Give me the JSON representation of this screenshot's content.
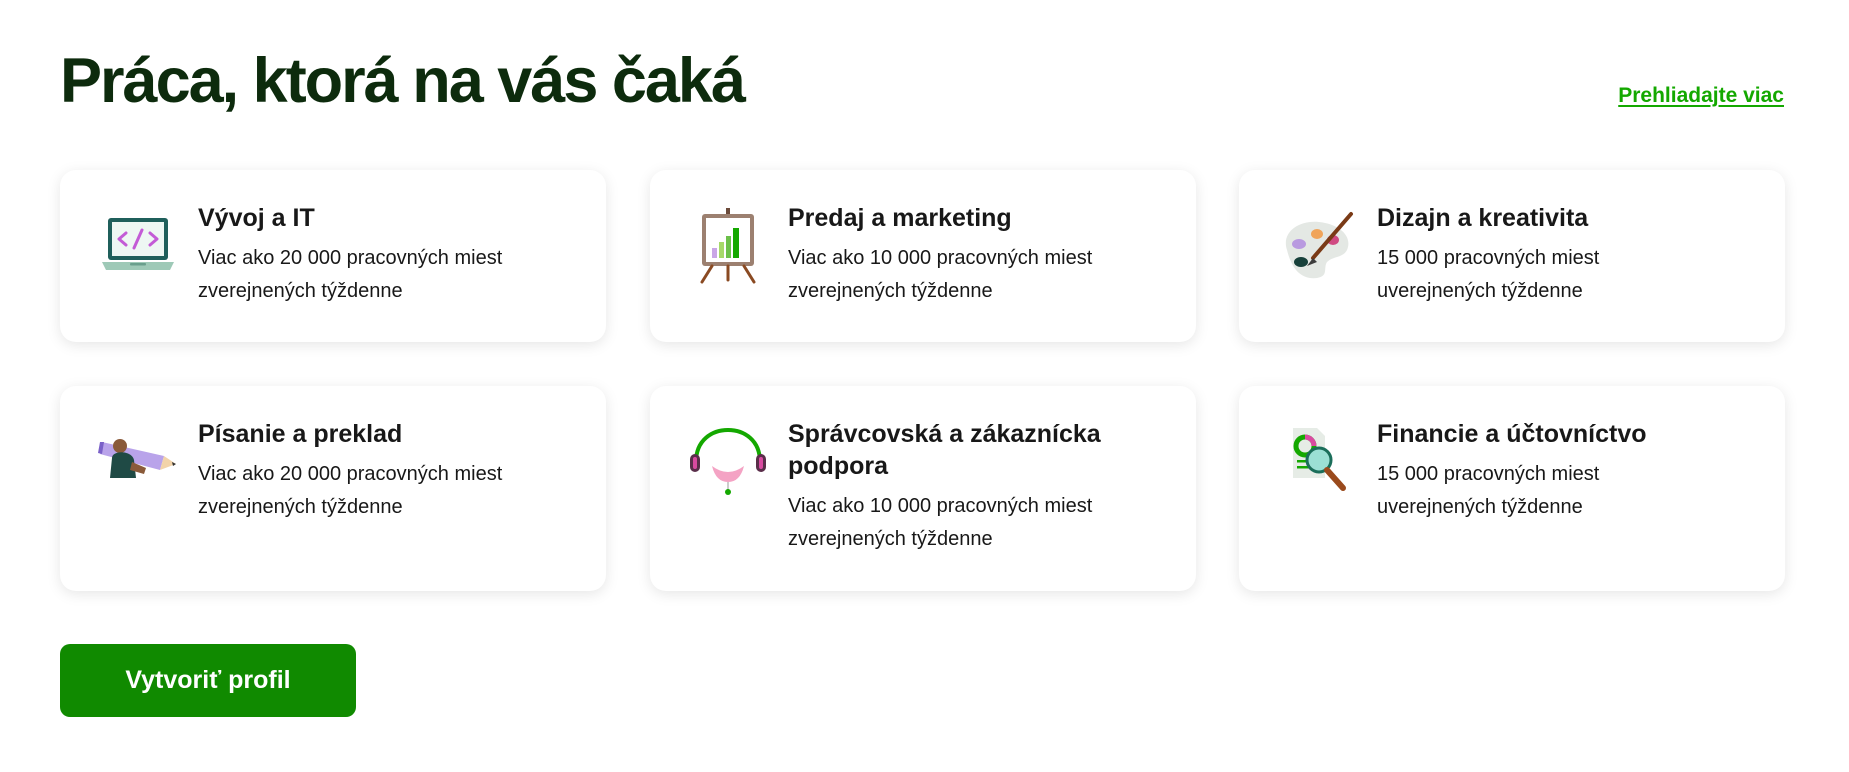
{
  "section": {
    "title": "Práca, ktorá na vás čaká",
    "browse_link": "Prehliadajte viac"
  },
  "categories": [
    {
      "title": "Vývoj a IT",
      "desc_line1": "Viac ako 20 000 pracovných miest",
      "desc_line2": "zverejnených týždenne",
      "icon": "laptop-code-icon"
    },
    {
      "title": "Predaj a marketing",
      "desc_line1": "Viac ako 10 000 pracovných miest",
      "desc_line2": "zverejnených týždenne",
      "icon": "chart-easel-icon"
    },
    {
      "title": "Dizajn a kreativita",
      "desc_line1": "15 000 pracovných miest",
      "desc_line2": "uverejnených týždenne",
      "icon": "paint-palette-icon"
    },
    {
      "title": "Písanie a preklad",
      "desc_line1": "Viac ako 20 000 pracovných miest",
      "desc_line2": "zverejnených týždenne",
      "icon": "pencil-writer-icon"
    },
    {
      "title_line1": "Správcovská a zákaznícka",
      "title_line2": "podpora",
      "desc_line1": "Viac ako 10 000 pracovných miest",
      "desc_line2": "zverejnených týždenne",
      "icon": "headset-icon"
    },
    {
      "title": "Financie a účtovníctvo",
      "desc_line1": "15 000 pracovných miest",
      "desc_line2": "uverejnených týždenne",
      "icon": "magnifier-report-icon"
    }
  ],
  "cta": {
    "label": "Vytvoriť profil"
  },
  "colors": {
    "title": "#0d2b0d",
    "link": "#14a800",
    "button": "#108a00",
    "button_text": "#ffffff"
  }
}
